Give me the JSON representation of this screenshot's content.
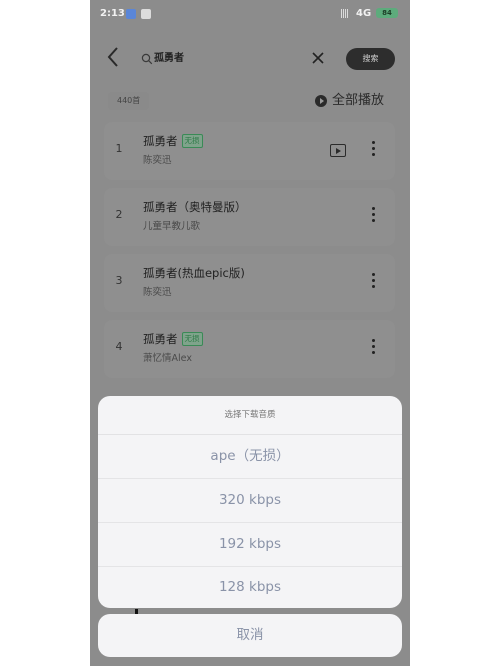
{
  "status_bar": {
    "time": "2:13",
    "signal": "||||",
    "network": "4G",
    "battery": "84"
  },
  "header": {
    "search_value": "孤勇者",
    "search_button": "搜索"
  },
  "list_info": {
    "count": "440首",
    "play_all": "全部播放"
  },
  "songs": [
    {
      "index": "1",
      "title": "孤勇者",
      "tag": "无损",
      "artist": "陈奕迅"
    },
    {
      "index": "2",
      "title": "孤勇者（奥特曼版）",
      "artist": "儿童早教儿歌"
    },
    {
      "index": "3",
      "title": "孤勇者(热血epic版)",
      "artist": "陈奕迅"
    },
    {
      "index": "4",
      "title": "孤勇者",
      "tag": "无损",
      "artist": "萧忆情Alex"
    }
  ],
  "quality_sheet": {
    "title": "选择下载音质",
    "options": [
      "ape（无损）",
      "320 kbps",
      "192 kbps",
      "128 kbps"
    ],
    "cancel": "取消"
  },
  "colors": {
    "overlay_bg": "#8c8c8c",
    "sheet_bg": "#f4f4f6",
    "sheet_text": "#8a93a8",
    "lossless_tag": "#2f7a48"
  }
}
